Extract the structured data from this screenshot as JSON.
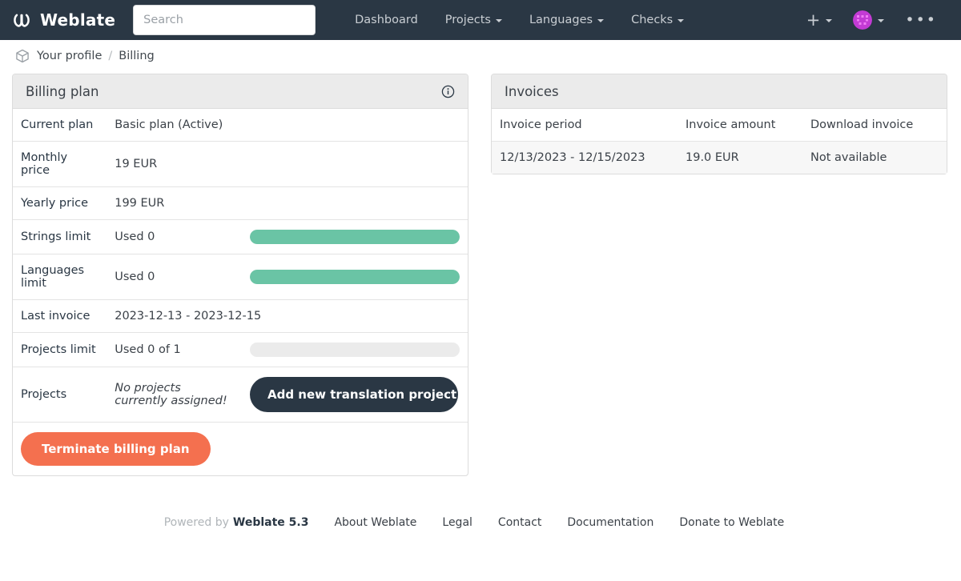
{
  "navbar": {
    "brand": "Weblate",
    "brand_logo_icon": "weblate-logo-icon",
    "search": {
      "placeholder": "Search",
      "value": ""
    },
    "links": [
      {
        "label": "Dashboard",
        "has_caret": false
      },
      {
        "label": "Projects",
        "has_caret": true
      },
      {
        "label": "Languages",
        "has_caret": true
      },
      {
        "label": "Checks",
        "has_caret": true
      }
    ],
    "add_icon": "plus-icon",
    "avatar_icon": "user-avatar-identicon",
    "menu_icon": "ellipsis-icon",
    "background_color": "#2a3744"
  },
  "breadcrumb": {
    "icon": "cube-icon",
    "items": [
      "Your profile",
      "Billing"
    ],
    "separator": "/"
  },
  "billing_panel": {
    "title": "Billing plan",
    "info_icon": "info-circle-icon",
    "rows": [
      {
        "label": "Current plan",
        "value": "Basic plan (Active)"
      },
      {
        "label": "Monthly price",
        "value": "19 EUR"
      },
      {
        "label": "Yearly price",
        "value": "199 EUR"
      },
      {
        "label": "Strings limit",
        "value": "Used 0",
        "progress": 100
      },
      {
        "label": "Languages limit",
        "value": "Used 0",
        "progress": 100
      },
      {
        "label": "Last invoice",
        "value": "2023-12-13 - 2023-12-15"
      },
      {
        "label": "Projects limit",
        "value": "Used 0 of 1",
        "progress": 0
      },
      {
        "label": "Projects",
        "value": "No projects currently assigned!"
      }
    ],
    "add_project_button": "Add new translation project",
    "terminate_button": "Terminate billing plan",
    "progress_fill_color": "#6ac4a5",
    "progress_track_color": "#ebebeb"
  },
  "invoices_panel": {
    "title": "Invoices",
    "columns": [
      "Invoice period",
      "Invoice amount",
      "Download invoice"
    ],
    "rows": [
      {
        "period": "12/13/2023 - 12/15/2023",
        "amount": "19.0 EUR",
        "download": "Not available"
      }
    ]
  },
  "footer": {
    "powered_by": "Powered by",
    "version": "Weblate 5.3",
    "links": [
      "About Weblate",
      "Legal",
      "Contact",
      "Documentation",
      "Donate to Weblate"
    ]
  }
}
